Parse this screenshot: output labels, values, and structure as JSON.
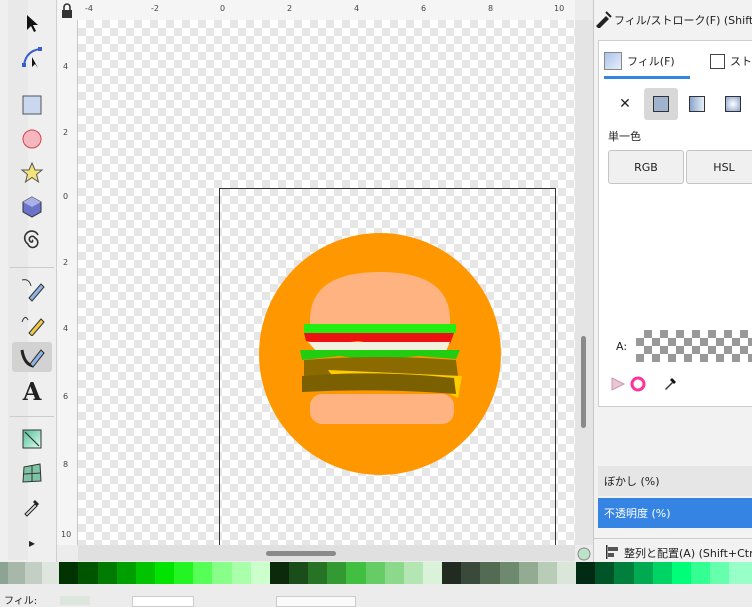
{
  "toolbox": {
    "tools": [
      {
        "name": "selector-tool"
      },
      {
        "name": "node-tool"
      },
      {
        "name": "rectangle-tool"
      },
      {
        "name": "ellipse-tool"
      },
      {
        "name": "star-tool"
      },
      {
        "name": "3d-box-tool"
      },
      {
        "name": "spiral-tool"
      },
      {
        "name": "pen-tool"
      },
      {
        "name": "pencil-tool"
      },
      {
        "name": "calligraphy-tool"
      },
      {
        "name": "text-tool"
      },
      {
        "name": "gradient-tool"
      },
      {
        "name": "mesh-tool"
      },
      {
        "name": "dropper-tool"
      },
      {
        "name": "more-tools"
      }
    ],
    "text_tool_glyph": "A",
    "more_glyph": "▸"
  },
  "rulers": {
    "horizontal": [
      "-4",
      "-2",
      "0",
      "2",
      "4",
      "6",
      "8",
      "10"
    ],
    "vertical": [
      "4",
      "2",
      "0",
      "2",
      "4",
      "6",
      "8",
      "10"
    ]
  },
  "panel": {
    "title": "フィル/ストローク(F) (Shift+Ctrl",
    "tab_fill": "フィル(F)",
    "tab_stroke": "ストロ",
    "flat_label": "単一色",
    "rgb": "RGB",
    "hsl": "HSL",
    "alpha_label": "A:",
    "blur_label": "ぼかし (%)",
    "opacity_label": "不透明度 (%)",
    "align_label": "整列と配置(A) (Shift+Ctrl",
    "no_paint_glyph": "✕"
  },
  "status": {
    "fill_label": "フィル:"
  },
  "colors": {
    "accent": "#3584e4",
    "orange": "#ff9800",
    "bun": "#ffb380"
  }
}
